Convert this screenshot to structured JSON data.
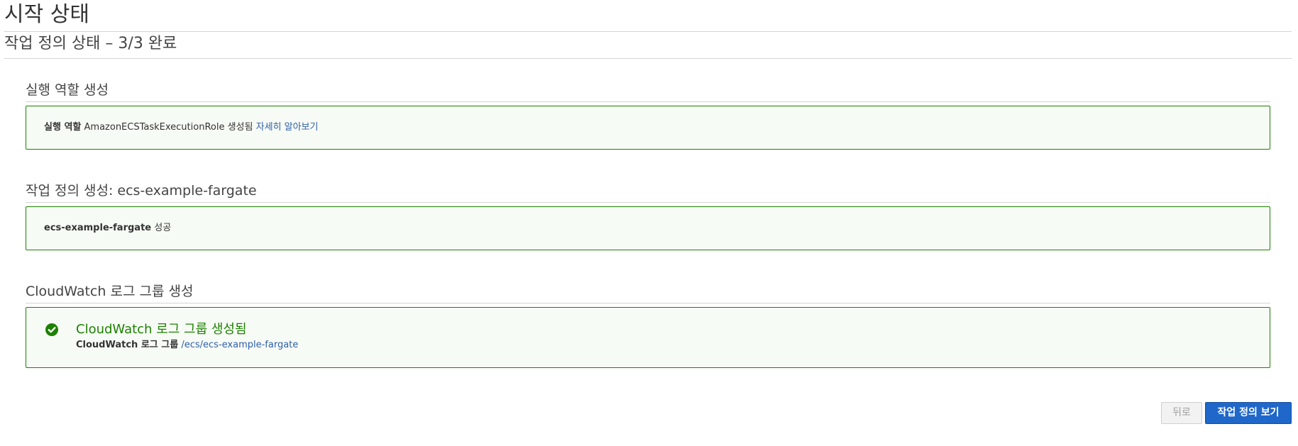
{
  "page": {
    "title": "시작 상태",
    "subtitle": "작업 정의 상태 – 3/3 완료"
  },
  "sections": [
    {
      "heading": "실행 역할 생성",
      "result": {
        "label_bold": "실행 역할",
        "text": "AmazonECSTaskExecutionRole 생성됨",
        "link": "자세히 알아보기"
      }
    },
    {
      "heading": "작업 정의 생성: ecs-example-fargate",
      "result": {
        "label_bold": "ecs-example-fargate",
        "text": "성공"
      }
    },
    {
      "heading": "CloudWatch 로그 그룹 생성",
      "result": {
        "icon": "check-circle-icon",
        "title": "CloudWatch 로그 그룹 생성됨",
        "label_bold": "CloudWatch 로그 그룹",
        "link": "/ecs/ecs-example-fargate"
      }
    }
  ],
  "buttons": {
    "back": "뒤로",
    "view_task_definition": "작업 정의 보기"
  },
  "colors": {
    "success": "#1d8102",
    "link": "#2f5faa",
    "primary": "#1f67c9"
  }
}
